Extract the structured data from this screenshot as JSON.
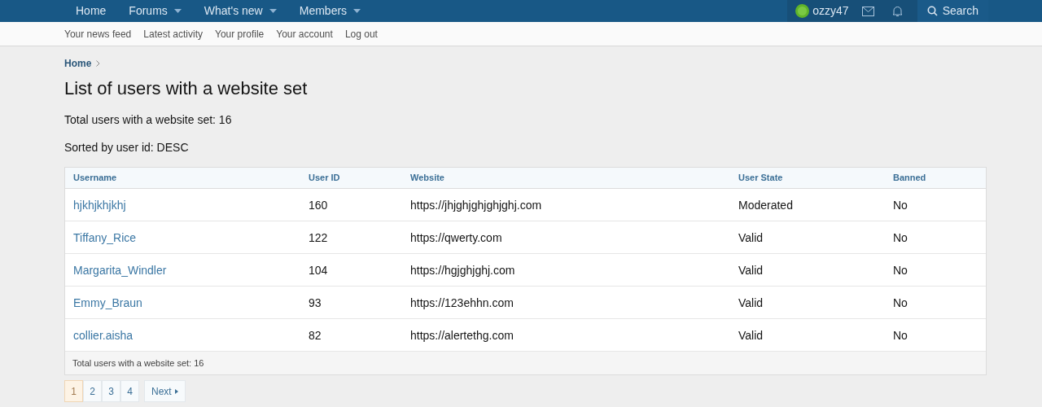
{
  "nav": {
    "items": [
      {
        "label": "Home",
        "has_menu": false
      },
      {
        "label": "Forums",
        "has_menu": true
      },
      {
        "label": "What's new",
        "has_menu": true
      },
      {
        "label": "Members",
        "has_menu": true
      }
    ],
    "user": {
      "name": "ozzy47"
    },
    "search": {
      "label": "Search"
    }
  },
  "subnav": [
    "Your news feed",
    "Latest activity",
    "Your profile",
    "Your account",
    "Log out"
  ],
  "breadcrumb": [
    "Home"
  ],
  "title": "List of users with a website set",
  "summary": [
    "Total users with a website set: 16",
    "Sorted by user id: DESC"
  ],
  "table": {
    "columns": [
      "Username",
      "User ID",
      "Website",
      "User State",
      "Banned"
    ],
    "rows": [
      {
        "username": "hjkhjkhjkhj",
        "user_id": "160",
        "website": "https://jhjghjghjghjghj.com",
        "state": "Moderated",
        "banned": "No"
      },
      {
        "username": "Tiffany_Rice",
        "user_id": "122",
        "website": "https://qwerty.com",
        "state": "Valid",
        "banned": "No"
      },
      {
        "username": "Margarita_Windler",
        "user_id": "104",
        "website": "https://hgjghjghj.com",
        "state": "Valid",
        "banned": "No"
      },
      {
        "username": "Emmy_Braun",
        "user_id": "93",
        "website": "https://123ehhn.com",
        "state": "Valid",
        "banned": "No"
      },
      {
        "username": "collier.aisha",
        "user_id": "82",
        "website": "https://alertethg.com",
        "state": "Valid",
        "banned": "No"
      }
    ],
    "footer": "Total users with a website set: 16"
  },
  "pagination": {
    "pages": [
      {
        "label": "1",
        "selected": true
      },
      {
        "label": "2",
        "selected": false
      },
      {
        "label": "3",
        "selected": false
      },
      {
        "label": "4",
        "selected": false
      }
    ],
    "next": "Next"
  }
}
